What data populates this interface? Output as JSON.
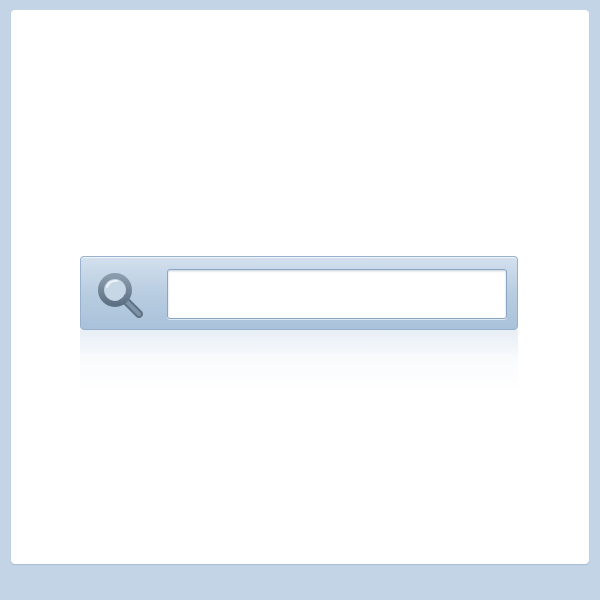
{
  "search": {
    "placeholder": "",
    "value": "",
    "icon": "search-icon"
  },
  "colors": {
    "background": "#c3d4e7",
    "panel": "#ffffff",
    "bar_top": "#d3e0ee",
    "bar_bottom": "#a9c2da",
    "icon": "#6f8293"
  }
}
